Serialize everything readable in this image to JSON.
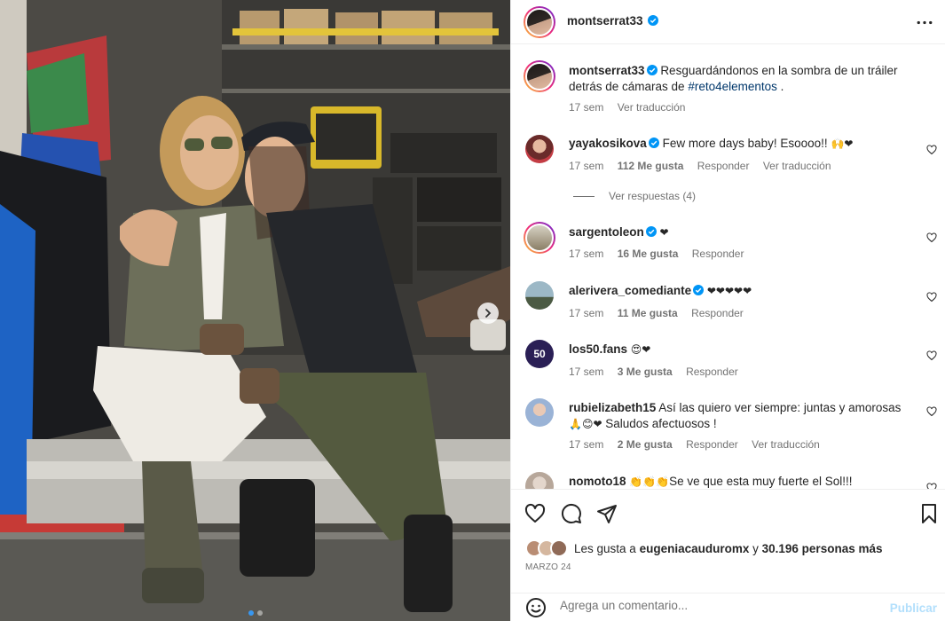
{
  "post": {
    "author": "montserrat33",
    "caption_user": "montserrat33",
    "caption_text": "Resguardándonos en la sombra de un tráiler detrás de cámaras de ",
    "caption_hashtag": "#reto4elementos",
    "caption_end": " .",
    "caption_time": "17 sem",
    "caption_translate": "Ver traducción"
  },
  "comments": [
    {
      "user": "yayakosikova",
      "verified": true,
      "text": "Few more days baby! Esoooo!!",
      "emoji": "🙌❤",
      "time": "17 sem",
      "likes": "112 Me gusta",
      "reply": "Responder",
      "translate": "Ver traducción",
      "view_replies": "Ver respuestas (4)"
    },
    {
      "user": "sargentoleon",
      "verified": true,
      "text": "",
      "emoji": "❤",
      "time": "17 sem",
      "likes": "16 Me gusta",
      "reply": "Responder"
    },
    {
      "user": "alerivera_comediante",
      "verified": true,
      "text": "",
      "emoji": "❤❤❤❤❤",
      "time": "17 sem",
      "likes": "11 Me gusta",
      "reply": "Responder"
    },
    {
      "user": "los50.fans",
      "verified": false,
      "text": "",
      "emoji": "😍❤",
      "time": "17 sem",
      "likes": "3 Me gusta",
      "reply": "Responder"
    },
    {
      "user": "rubielizabeth15",
      "verified": false,
      "text": "Así las quiero ver siempre: juntas y amorosas",
      "emoji": "🙏😊❤",
      "text2": " Saludos afectuosos !",
      "time": "17 sem",
      "likes": "2 Me gusta",
      "reply": "Responder",
      "translate": "Ver traducción"
    },
    {
      "user": "nomoto18",
      "verified": false,
      "text": "Se ve que esta muy fuerte el Sol!!!",
      "emoji": "👏👏👏"
    }
  ],
  "likes": {
    "prefix": "Les gusta a ",
    "user": "eugeniacauduromx",
    "middle": " y ",
    "count": "30.196 personas más"
  },
  "date": "MARZO 24",
  "add_comment": {
    "placeholder": "Agrega un comentario...",
    "publish": "Publicar"
  },
  "carousel": {
    "slides": 2,
    "active": 0
  },
  "colors": {
    "verified": "#0095f6",
    "link": "#00376b",
    "meta": "#737373",
    "like_red": "#ed4956",
    "publish_disabled": "#b2dffc"
  },
  "icons": [
    "more-icon",
    "heart-icon",
    "comment-icon",
    "share-icon",
    "bookmark-icon",
    "emoji-icon",
    "chevron-right-icon",
    "verified-icon"
  ]
}
